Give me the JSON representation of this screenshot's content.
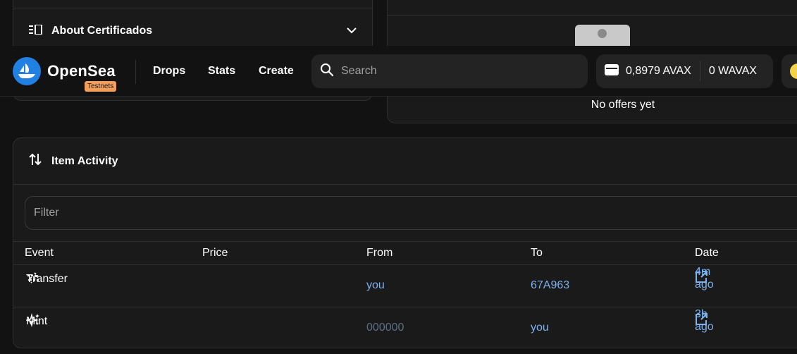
{
  "about": {
    "title": "About Certificados"
  },
  "offers": {
    "empty_text": "No offers yet"
  },
  "navbar": {
    "brand": "OpenSea",
    "badge": "Testnets",
    "links": [
      "Drops",
      "Stats",
      "Create"
    ],
    "search_placeholder": "Search",
    "wallet": {
      "avax": "0,8979 AVAX",
      "wavax": "0 WAVAX"
    }
  },
  "activity": {
    "title": "Item Activity",
    "filter_placeholder": "Filter",
    "columns": [
      "Event",
      "Price",
      "From",
      "To",
      "Date"
    ],
    "rows": [
      {
        "event": "Transfer",
        "price": "",
        "from": "you",
        "to": "67A963",
        "date": "4m ago"
      },
      {
        "event": "Mint",
        "price": "",
        "from": "000000",
        "to": "you",
        "date": "3h ago"
      }
    ]
  },
  "colors": {
    "link": "#7cb2f0",
    "brand_blue": "#2081e2",
    "badge": "#f59e5a"
  }
}
